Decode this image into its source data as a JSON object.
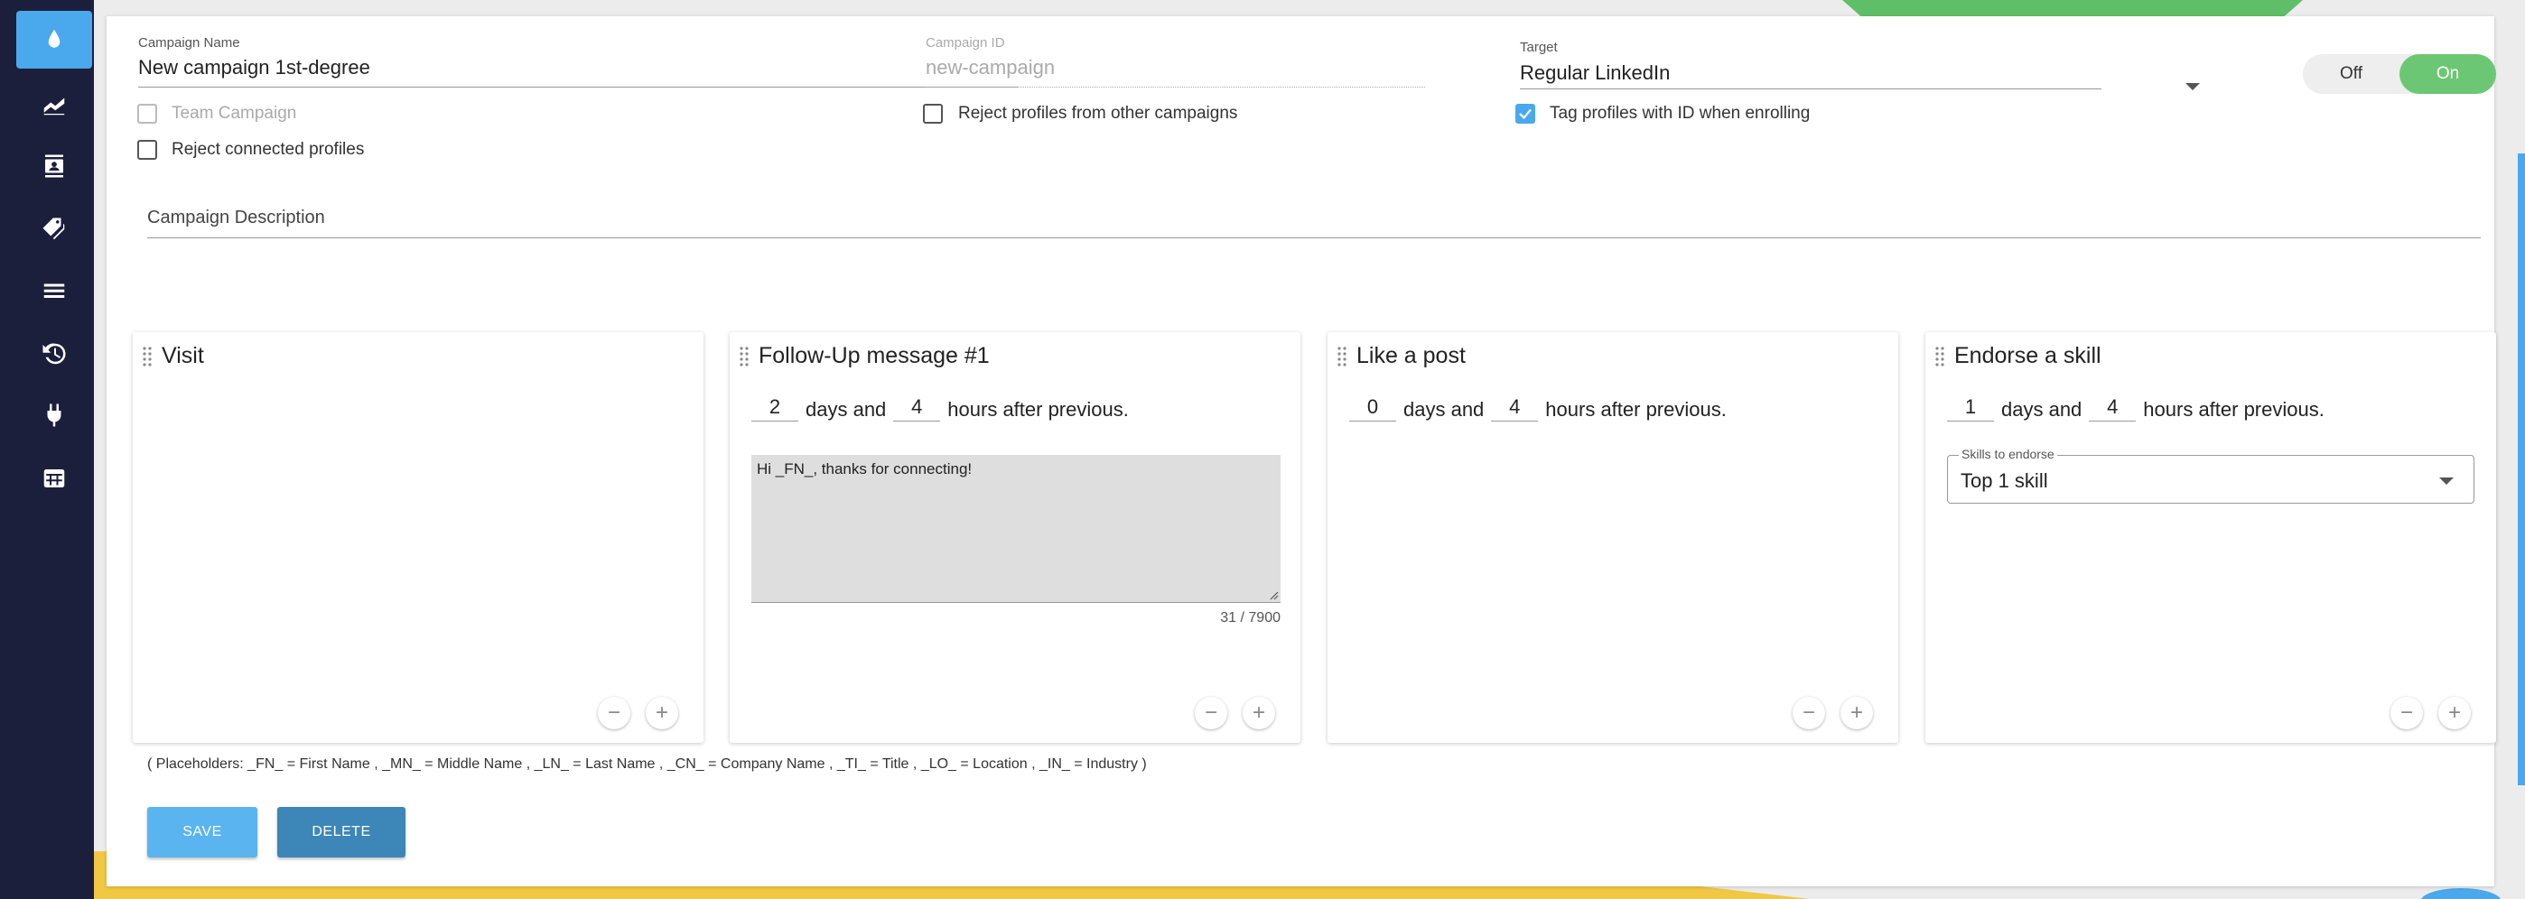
{
  "sidebar": {
    "items": [
      {
        "icon": "drop-icon",
        "active": true
      },
      {
        "icon": "chart-icon"
      },
      {
        "icon": "contacts-icon"
      },
      {
        "icon": "tags-icon"
      },
      {
        "icon": "list-icon"
      },
      {
        "icon": "history-icon"
      },
      {
        "icon": "plug-icon"
      },
      {
        "icon": "store-icon"
      }
    ]
  },
  "campaign": {
    "name_label": "Campaign Name",
    "name_value": "New campaign 1st-degree",
    "id_label": "Campaign ID",
    "id_value": "new-campaign",
    "target_label": "Target",
    "target_value": "Regular LinkedIn",
    "toggle_off": "Off",
    "toggle_on": "On",
    "toggle_state": "On"
  },
  "options": {
    "team_campaign": {
      "label": "Team Campaign",
      "checked": false,
      "disabled": true
    },
    "reject_other": {
      "label": "Reject profiles from other campaigns",
      "checked": false
    },
    "tag_profiles": {
      "label": "Tag profiles with ID when enrolling",
      "checked": true
    },
    "reject_connected": {
      "label": "Reject connected profiles",
      "checked": false
    }
  },
  "description": {
    "label": "Campaign Description"
  },
  "steps": [
    {
      "title": "Visit"
    },
    {
      "title": "Follow-Up message #1",
      "days": "2",
      "hours": "4",
      "days_text": "days and",
      "hours_text": "hours after previous.",
      "message": "Hi _FN_, thanks for connecting!",
      "counter": "31 / 7900"
    },
    {
      "title": "Like a post",
      "days": "0",
      "hours": "4",
      "days_text": "days and",
      "hours_text": "hours after previous."
    },
    {
      "title": "Endorse a skill",
      "days": "1",
      "hours": "4",
      "days_text": "days and",
      "hours_text": "hours after previous.",
      "skills_label": "Skills to endorse",
      "skills_value": "Top 1 skill"
    }
  ],
  "step_controls": {
    "minus": "−",
    "plus": "+"
  },
  "placeholders": "( Placeholders: _FN_ = First Name , _MN_ = Middle Name , _LN_ = Last Name , _CN_ = Company Name , _TI_ = Title , _LO_ = Location , _IN_ = Industry )",
  "actions": {
    "save": "SAVE",
    "delete": "DELETE"
  },
  "colors": {
    "sidebar": "#1c1f3b",
    "accent": "#4aa8ec",
    "toggle_on": "#6cc774",
    "delete": "#3d86b8"
  }
}
